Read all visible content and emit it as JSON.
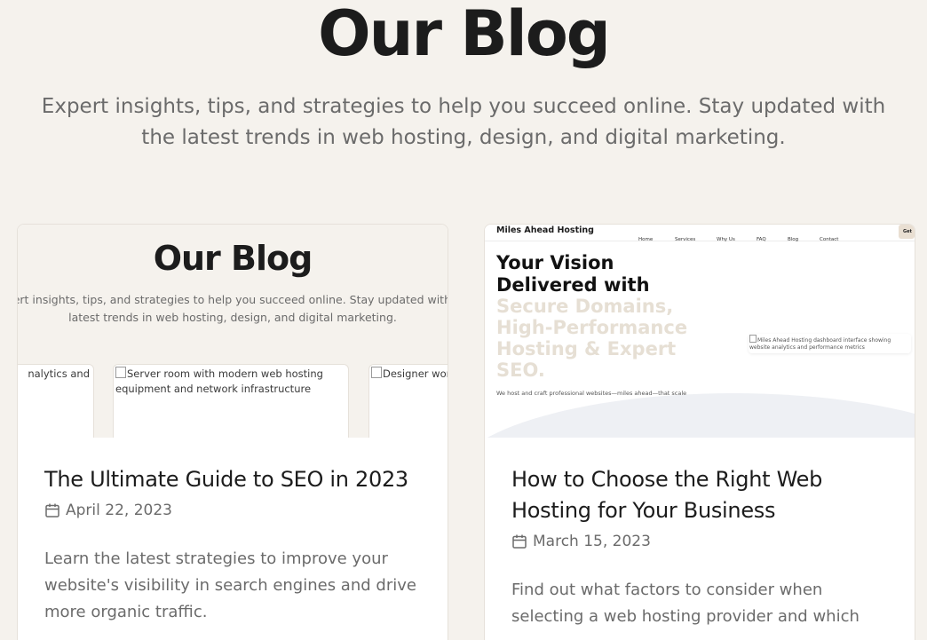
{
  "hero": {
    "title": "Our Blog",
    "subtitle": "Expert insights, tips, and strategies to help you succeed online. Stay updated with the latest trends in web hosting, design, and digital marketing."
  },
  "posts": [
    {
      "title": "The Ultimate Guide to SEO in 2023",
      "date": "April 22, 2023",
      "excerpt": "Learn the latest strategies to improve your website's visibility in search engines and drive more organic traffic.",
      "calendar_icon": "calendar-icon",
      "thumbnail": {
        "title": "Our Blog",
        "subtitle": "Expert insights, tips, and strategies to help you succeed online. Stay updated with the latest trends in web hosting, design, and digital marketing.",
        "cards": [
          {
            "alt": "nalytics and"
          },
          {
            "alt": "Server room with modern web hosting equipment and network infrastructure"
          },
          {
            "alt": "Designer working on creative UI elements"
          }
        ]
      }
    },
    {
      "title": "How to Choose the Right Web Hosting for Your Business",
      "date": "March 15, 2023",
      "excerpt": "Find out what factors to consider when selecting a web hosting provider and which",
      "calendar_icon": "calendar-icon",
      "thumbnail": {
        "brand": "Miles Ahead Hosting",
        "nav": [
          "Home",
          "Services",
          "Why Us",
          "FAQ",
          "Blog",
          "Contact"
        ],
        "cta": "Get",
        "hero_dark": "Your Vision Delivered with",
        "hero_light": "Secure Domains, High-Performance Hosting & Expert SEO.",
        "hero_text": "We host and craft professional websites—miles ahead—that scale",
        "dash_alt": "Miles Ahead Hosting dashboard interface showing website analytics and performance metrics"
      }
    }
  ],
  "colors": {
    "background": "#f5f2ed",
    "card": "#ffffff",
    "heading": "#1c1c1c",
    "muted": "#6b6b6b",
    "hero_light_text": "#e6dfd4"
  }
}
